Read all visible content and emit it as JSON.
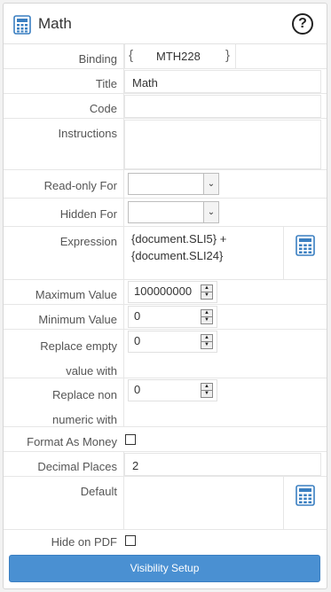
{
  "header": {
    "title": "Math",
    "help_icon": "question-circle-icon",
    "calc_icon": "calculator-icon"
  },
  "fields": {
    "binding": {
      "label": "Binding",
      "open": "{",
      "value": "MTH228",
      "close": "}"
    },
    "title": {
      "label": "Title",
      "value": "Math"
    },
    "code": {
      "label": "Code",
      "value": ""
    },
    "instructions": {
      "label": "Instructions",
      "value": ""
    },
    "read_only_for": {
      "label": "Read-only For",
      "value": ""
    },
    "hidden_for": {
      "label": "Hidden For",
      "value": ""
    },
    "expression": {
      "label": "Expression",
      "value": "{document.SLI5} + {document.SLI24}"
    },
    "maximum_value": {
      "label": "Maximum Value",
      "value": "100000000"
    },
    "minimum_value": {
      "label": "Minimum Value",
      "value": "0"
    },
    "replace_empty": {
      "label": "Replace empty value with",
      "value": "0"
    },
    "replace_non_numeric": {
      "label": "Replace non numeric with",
      "value": "0"
    },
    "format_as_money": {
      "label": "Format As Money",
      "checked": false
    },
    "decimal_places": {
      "label": "Decimal Places",
      "value": "2"
    },
    "default": {
      "label": "Default",
      "value": ""
    },
    "hide_on_pdf": {
      "label": "Hide on PDF",
      "checked": false
    }
  },
  "buttons": {
    "visibility_setup": "Visibility Setup"
  },
  "colors": {
    "primary_button": "#4a90d2",
    "calc_icon": "#3a7fc1"
  }
}
